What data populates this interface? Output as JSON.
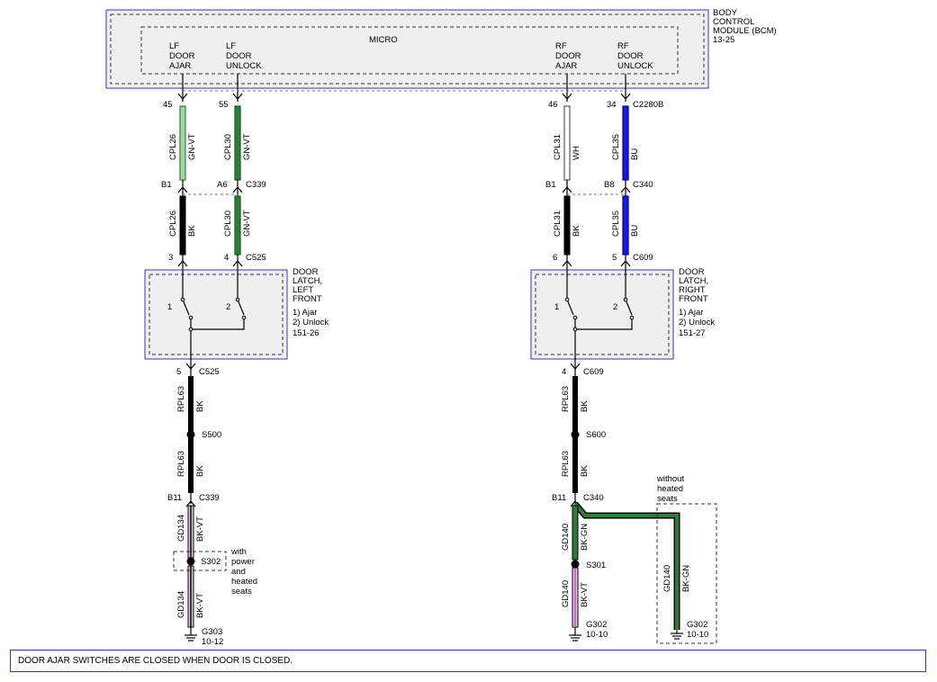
{
  "module": {
    "name_lines": [
      "BODY",
      "CONTROL",
      "MODULE (BCM)",
      "13-25"
    ],
    "micro_label": "MICRO",
    "pins": {
      "lf_ajar": [
        "LF",
        "DOOR",
        "AJAR"
      ],
      "lf_unlock": [
        "LF",
        "DOOR",
        "UNLOCK"
      ],
      "rf_ajar": [
        "RF",
        "DOOR",
        "AJAR"
      ],
      "rf_unlock": [
        "RF",
        "DOOR",
        "UNLOCK"
      ]
    }
  },
  "pin_numbers": {
    "lf_ajar": "45",
    "lf_unlock": "55",
    "rf_ajar": "46",
    "rf_unlock": "34",
    "bcm_connector": "C2280B"
  },
  "wires": {
    "lf_ajar_upper": {
      "circuit": "CPL26",
      "color": "GN-VT"
    },
    "lf_unlock_upper": {
      "circuit": "CPL30",
      "color": "GN-VT"
    },
    "rf_ajar_upper": {
      "circuit": "CPL31",
      "color": "WH"
    },
    "rf_unlock_upper": {
      "circuit": "CPL35",
      "color": "BU"
    },
    "lf_ajar_lower": {
      "circuit": "CPL26",
      "color": "BK"
    },
    "lf_unlock_lower": {
      "circuit": "CPL30",
      "color": "GN-VT"
    },
    "rf_ajar_lower": {
      "circuit": "CPL31",
      "color": "BK"
    },
    "rf_unlock_lower": {
      "circuit": "CPL35",
      "color": "BU"
    },
    "lf_ground_1": {
      "circuit": "RPL63",
      "color": "BK"
    },
    "lf_ground_2": {
      "circuit": "RPL63",
      "color": "BK"
    },
    "rf_ground_1": {
      "circuit": "RPL63",
      "color": "BK"
    },
    "rf_ground_2": {
      "circuit": "RPL63",
      "color": "BK"
    },
    "lf_gd_1": {
      "circuit": "GD134",
      "color": "BK-VT"
    },
    "lf_gd_2": {
      "circuit": "GD134",
      "color": "BK-VT"
    },
    "rf_gd_1": {
      "circuit": "GD140",
      "color": "BK-GN"
    },
    "rf_gd_2": {
      "circuit": "GD140",
      "color": "BK-VT"
    },
    "rf_gd_alt": {
      "circuit": "GD140",
      "color": "BK-GN"
    }
  },
  "connectors": {
    "lf_c339_top": {
      "pin_a": "B1",
      "pin_b": "A6",
      "name": "C339"
    },
    "rf_c340_top": {
      "pin_a": "B1",
      "pin_b": "B8",
      "name": "C340"
    },
    "lf_c525_top": {
      "pin_a": "3",
      "pin_b": "4",
      "name": "C525"
    },
    "rf_c609_top": {
      "pin_a": "6",
      "pin_b": "5",
      "name": "C609"
    },
    "lf_c525_bottom": {
      "pin": "5",
      "name": "C525"
    },
    "rf_c609_bottom": {
      "pin": "4",
      "name": "C609"
    },
    "lf_c339_bottom": {
      "pin": "B11",
      "name": "C339"
    },
    "rf_c340_bottom": {
      "pin": "B11",
      "name": "C340"
    }
  },
  "latches": {
    "left": {
      "lines": [
        "DOOR",
        "LATCH,",
        "LEFT",
        "FRONT",
        "1) Ajar",
        "2) Unlock",
        "151-26"
      ],
      "switch1": "1",
      "switch2": "2"
    },
    "right": {
      "lines": [
        "DOOR",
        "LATCH,",
        "RIGHT",
        "FRONT",
        "1) Ajar",
        "2) Unlock",
        "151-27"
      ],
      "switch1": "1",
      "switch2": "2"
    }
  },
  "splices": {
    "lf_1": "S500",
    "lf_2": "S302",
    "rf_1": "S600",
    "rf_2": "S301"
  },
  "notes": {
    "lf_option": [
      "with",
      "power",
      "and",
      "heated",
      "seats"
    ],
    "rf_option": [
      "without",
      "heated",
      "seats"
    ]
  },
  "grounds": {
    "lf": {
      "name": "G303",
      "ref": "10-12"
    },
    "rf": {
      "name": "G302",
      "ref": "10-10"
    },
    "rf_alt": {
      "name": "G302",
      "ref": "10-10"
    }
  },
  "footer_note": "DOOR AJAR SWITCHES ARE CLOSED WHEN DOOR IS CLOSED.",
  "colors": {
    "border": "#3333cc",
    "green": "#2e7d32",
    "light_green": "#a5d6a7",
    "blue": "#1515ee",
    "black": "#000000",
    "violet": "#cc66cc",
    "box_fill": "#f0f0f0"
  }
}
